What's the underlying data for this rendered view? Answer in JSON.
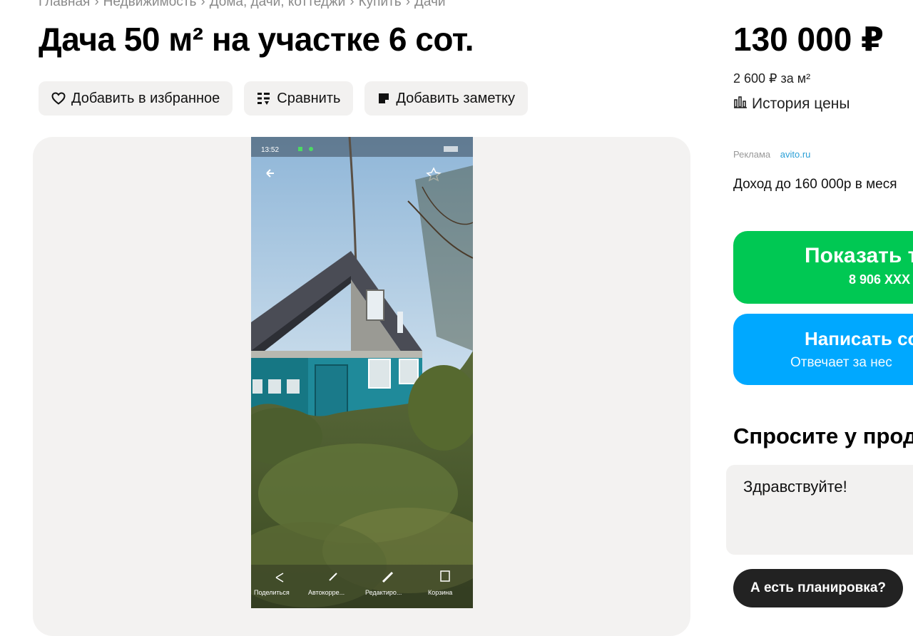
{
  "breadcrumb": {
    "items": [
      "Главная",
      "Недвижимость",
      "Дома, дачи, коттеджи",
      "Купить",
      "Дачи"
    ],
    "separator": "›"
  },
  "listing": {
    "title": "Дача 50 м² на участке 6 сот."
  },
  "actions": {
    "favorite": "Добавить в избранное",
    "compare": "Сравнить",
    "note": "Добавить заметку"
  },
  "gallery": {
    "photo_status_time": "13:52",
    "photo_captions": [
      "Поделиться",
      "Автокорре...",
      "Редактиро...",
      "Корзина"
    ]
  },
  "pricing": {
    "price": "130 000 ₽",
    "per_m": "2 600 ₽ за м²",
    "history": "История цены"
  },
  "ad": {
    "label": "Реклама",
    "link": "avito.ru",
    "text": "Доход до 160 000р в меся"
  },
  "contact": {
    "show_phone": "Показать т",
    "phone_masked": "8 906 XXX",
    "write": "Написать со",
    "reply_time": "Отвечает за нес"
  },
  "ask": {
    "title": "Спросите у прод",
    "message_value": "Здравствуйте!",
    "chip": "А есть планировка?"
  },
  "colors": {
    "green": "#00c853",
    "blue": "#00a8ff",
    "chip_dark": "#222222",
    "panel_bg": "#f3f2f1"
  }
}
